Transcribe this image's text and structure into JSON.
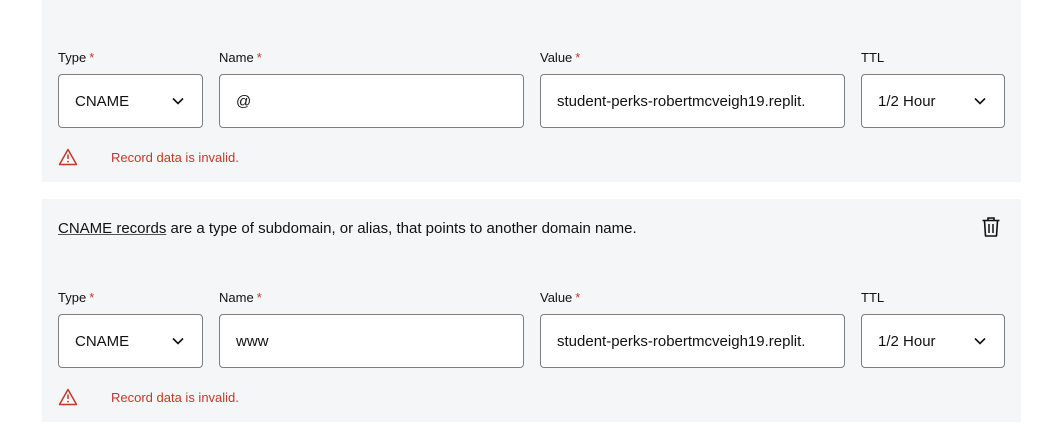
{
  "labels": {
    "type": "Type",
    "name": "Name",
    "value": "Value",
    "ttl": "TTL",
    "required_mark": "*"
  },
  "records": [
    {
      "type": "CNAME",
      "name": "@",
      "value": "student-perks-robertmcveigh19.replit.",
      "ttl": "1/2 Hour",
      "error": "Record data is invalid."
    },
    {
      "description_link": "CNAME records",
      "description_text": " are a type of subdomain, or alias, that points to another domain name.",
      "type": "CNAME",
      "name": "www",
      "value": "student-perks-robertmcveigh19.replit.",
      "ttl": "1/2 Hour",
      "error": "Record data is invalid."
    }
  ],
  "icons": {
    "delete": "trash-icon",
    "warning": "warning-triangle-icon",
    "dropdown": "chevron-down-icon"
  },
  "colors": {
    "panel_bg": "#f5f6f7",
    "error": "#c0392b",
    "border": "#7d7d7d"
  }
}
